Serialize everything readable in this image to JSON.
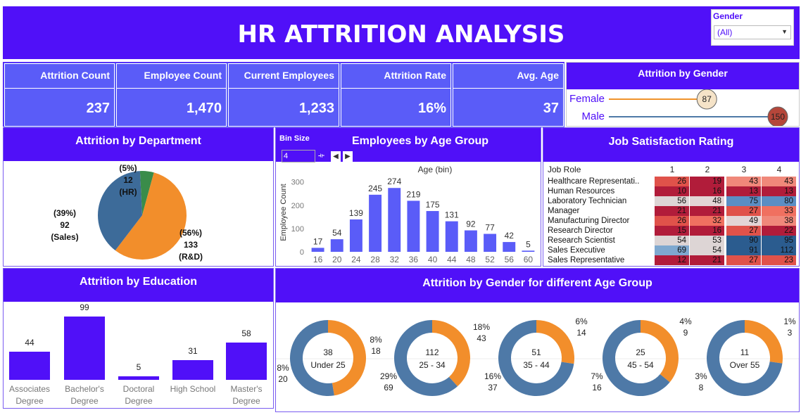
{
  "header": {
    "title": "HR ATTRITION ANALYSIS"
  },
  "filter": {
    "label": "Gender",
    "value": "(All)"
  },
  "kpis": [
    {
      "label": "Attrition Count",
      "value": "237"
    },
    {
      "label": "Employee Count",
      "value": "1,470"
    },
    {
      "label": "Current Employees",
      "value": "1,233"
    },
    {
      "label": "Attrition Rate",
      "value": "16%"
    },
    {
      "label": "Avg. Age",
      "value": "37"
    }
  ],
  "gender_panel": {
    "title": "Attrition by Gender",
    "rows": [
      {
        "label": "Female",
        "value": "87",
        "num": 87,
        "color": "#f0932b",
        "dot": "#f5e3c8"
      },
      {
        "label": "Male",
        "value": "150",
        "num": 150,
        "color": "#4e79a7",
        "dot": "#b5463a"
      }
    ]
  },
  "department": {
    "title": "Attrition by Department",
    "slices": [
      {
        "name": "HR",
        "pct": "(5%)",
        "value": "12",
        "label": "(HR)",
        "num": 12,
        "color": "#3a8c4a"
      },
      {
        "name": "R&D",
        "pct": "(56%)",
        "value": "133",
        "label": "(R&D)",
        "num": 133,
        "color": "#f28e2b"
      },
      {
        "name": "Sales",
        "pct": "(39%)",
        "value": "92",
        "label": "(Sales)",
        "num": 92,
        "color": "#3d6b99"
      }
    ]
  },
  "age_group": {
    "title": "Employees by Age Group",
    "bin_size_label": "Bin Size",
    "bin_size_value": "4",
    "axis_title": "Age (bin)",
    "ylabel": "Employee Count"
  },
  "job_satisfaction": {
    "title": "Job Satisfaction Rating",
    "row_header": "Job Role",
    "columns": [
      "1",
      "2",
      "3",
      "4"
    ],
    "rows": [
      {
        "role": "Healthcare Representati..",
        "values": [
          "26",
          "19",
          "43",
          "43"
        ]
      },
      {
        "role": "Human Resources",
        "values": [
          "10",
          "16",
          "13",
          "13"
        ]
      },
      {
        "role": "Laboratory Technician",
        "values": [
          "56",
          "48",
          "75",
          "80"
        ]
      },
      {
        "role": "Manager",
        "values": [
          "21",
          "21",
          "27",
          "33"
        ]
      },
      {
        "role": "Manufacturing Director",
        "values": [
          "26",
          "32",
          "49",
          "38"
        ]
      },
      {
        "role": "Research Director",
        "values": [
          "15",
          "16",
          "27",
          "22"
        ]
      },
      {
        "role": "Research Scientist",
        "values": [
          "54",
          "53",
          "90",
          "95"
        ]
      },
      {
        "role": "Sales Executive",
        "values": [
          "69",
          "54",
          "91",
          "112"
        ]
      },
      {
        "role": "Sales Representative",
        "values": [
          "12",
          "21",
          "27",
          "23"
        ]
      }
    ]
  },
  "education": {
    "title": "Attrition by Education",
    "bars": [
      {
        "line1": "Associates",
        "line2": "Degree",
        "value": "44",
        "num": 44
      },
      {
        "line1": "Bachelor's",
        "line2": "Degree",
        "value": "99",
        "num": 99
      },
      {
        "line1": "Doctoral",
        "line2": "Degree",
        "value": "5",
        "num": 5
      },
      {
        "line1": "High School",
        "line2": "",
        "value": "31",
        "num": 31
      },
      {
        "line1": "Master's",
        "line2": "Degree",
        "value": "58",
        "num": 58
      }
    ]
  },
  "gender_age": {
    "title": "Attrition by Gender for different Age Group",
    "donuts": [
      {
        "center_value": "38",
        "center_label": "Under 25",
        "f_pct": "8%",
        "f_val": "18",
        "m_pct": "8%",
        "m_val": "20",
        "f_num": 18,
        "m_num": 20
      },
      {
        "center_value": "112",
        "center_label": "25 - 34",
        "f_pct": "18%",
        "f_val": "43",
        "m_pct": "29%",
        "m_val": "69",
        "f_num": 43,
        "m_num": 69
      },
      {
        "center_value": "51",
        "center_label": "35 - 44",
        "f_pct": "6%",
        "f_val": "14",
        "m_pct": "16%",
        "m_val": "37",
        "f_num": 14,
        "m_num": 37
      },
      {
        "center_value": "25",
        "center_label": "45 - 54",
        "f_pct": "4%",
        "f_val": "9",
        "m_pct": "7%",
        "m_val": "16",
        "f_num": 9,
        "m_num": 16
      },
      {
        "center_value": "11",
        "center_label": "Over 55",
        "f_pct": "1%",
        "f_val": "3",
        "m_pct": "3%",
        "m_val": "8",
        "f_num": 3,
        "m_num": 8
      }
    ]
  },
  "chart_data": [
    {
      "type": "bar",
      "title": "Employees by Age Group",
      "xlabel": "Age (bin)",
      "ylabel": "Employee Count",
      "categories": [
        "16",
        "20",
        "24",
        "28",
        "32",
        "36",
        "40",
        "44",
        "48",
        "52",
        "56",
        "60"
      ],
      "values": [
        17,
        54,
        139,
        245,
        274,
        219,
        175,
        131,
        92,
        77,
        42,
        5
      ],
      "yticks": [
        "0",
        "100",
        "200",
        "300"
      ],
      "ylim": [
        0,
        320
      ],
      "color": "#5a5cf8"
    }
  ]
}
